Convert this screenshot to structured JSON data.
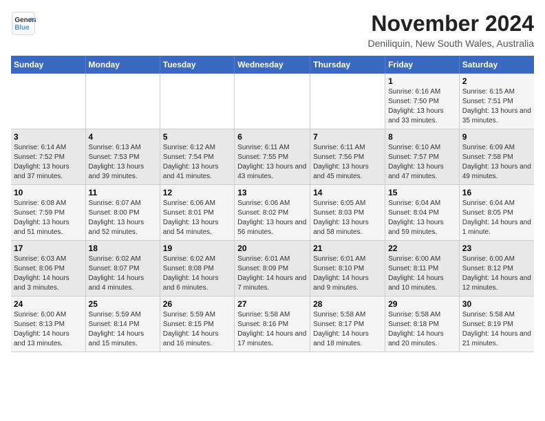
{
  "logo": {
    "line1": "General",
    "line2": "Blue"
  },
  "title": "November 2024",
  "subtitle": "Deniliquin, New South Wales, Australia",
  "weekdays": [
    "Sunday",
    "Monday",
    "Tuesday",
    "Wednesday",
    "Thursday",
    "Friday",
    "Saturday"
  ],
  "weeks": [
    [
      {
        "day": "",
        "sunrise": "",
        "sunset": "",
        "daylight": ""
      },
      {
        "day": "",
        "sunrise": "",
        "sunset": "",
        "daylight": ""
      },
      {
        "day": "",
        "sunrise": "",
        "sunset": "",
        "daylight": ""
      },
      {
        "day": "",
        "sunrise": "",
        "sunset": "",
        "daylight": ""
      },
      {
        "day": "",
        "sunrise": "",
        "sunset": "",
        "daylight": ""
      },
      {
        "day": "1",
        "sunrise": "Sunrise: 6:16 AM",
        "sunset": "Sunset: 7:50 PM",
        "daylight": "Daylight: 13 hours and 33 minutes."
      },
      {
        "day": "2",
        "sunrise": "Sunrise: 6:15 AM",
        "sunset": "Sunset: 7:51 PM",
        "daylight": "Daylight: 13 hours and 35 minutes."
      }
    ],
    [
      {
        "day": "3",
        "sunrise": "Sunrise: 6:14 AM",
        "sunset": "Sunset: 7:52 PM",
        "daylight": "Daylight: 13 hours and 37 minutes."
      },
      {
        "day": "4",
        "sunrise": "Sunrise: 6:13 AM",
        "sunset": "Sunset: 7:53 PM",
        "daylight": "Daylight: 13 hours and 39 minutes."
      },
      {
        "day": "5",
        "sunrise": "Sunrise: 6:12 AM",
        "sunset": "Sunset: 7:54 PM",
        "daylight": "Daylight: 13 hours and 41 minutes."
      },
      {
        "day": "6",
        "sunrise": "Sunrise: 6:11 AM",
        "sunset": "Sunset: 7:55 PM",
        "daylight": "Daylight: 13 hours and 43 minutes."
      },
      {
        "day": "7",
        "sunrise": "Sunrise: 6:11 AM",
        "sunset": "Sunset: 7:56 PM",
        "daylight": "Daylight: 13 hours and 45 minutes."
      },
      {
        "day": "8",
        "sunrise": "Sunrise: 6:10 AM",
        "sunset": "Sunset: 7:57 PM",
        "daylight": "Daylight: 13 hours and 47 minutes."
      },
      {
        "day": "9",
        "sunrise": "Sunrise: 6:09 AM",
        "sunset": "Sunset: 7:58 PM",
        "daylight": "Daylight: 13 hours and 49 minutes."
      }
    ],
    [
      {
        "day": "10",
        "sunrise": "Sunrise: 6:08 AM",
        "sunset": "Sunset: 7:59 PM",
        "daylight": "Daylight: 13 hours and 51 minutes."
      },
      {
        "day": "11",
        "sunrise": "Sunrise: 6:07 AM",
        "sunset": "Sunset: 8:00 PM",
        "daylight": "Daylight: 13 hours and 52 minutes."
      },
      {
        "day": "12",
        "sunrise": "Sunrise: 6:06 AM",
        "sunset": "Sunset: 8:01 PM",
        "daylight": "Daylight: 13 hours and 54 minutes."
      },
      {
        "day": "13",
        "sunrise": "Sunrise: 6:06 AM",
        "sunset": "Sunset: 8:02 PM",
        "daylight": "Daylight: 13 hours and 56 minutes."
      },
      {
        "day": "14",
        "sunrise": "Sunrise: 6:05 AM",
        "sunset": "Sunset: 8:03 PM",
        "daylight": "Daylight: 13 hours and 58 minutes."
      },
      {
        "day": "15",
        "sunrise": "Sunrise: 6:04 AM",
        "sunset": "Sunset: 8:04 PM",
        "daylight": "Daylight: 13 hours and 59 minutes."
      },
      {
        "day": "16",
        "sunrise": "Sunrise: 6:04 AM",
        "sunset": "Sunset: 8:05 PM",
        "daylight": "Daylight: 14 hours and 1 minute."
      }
    ],
    [
      {
        "day": "17",
        "sunrise": "Sunrise: 6:03 AM",
        "sunset": "Sunset: 8:06 PM",
        "daylight": "Daylight: 14 hours and 3 minutes."
      },
      {
        "day": "18",
        "sunrise": "Sunrise: 6:02 AM",
        "sunset": "Sunset: 8:07 PM",
        "daylight": "Daylight: 14 hours and 4 minutes."
      },
      {
        "day": "19",
        "sunrise": "Sunrise: 6:02 AM",
        "sunset": "Sunset: 8:08 PM",
        "daylight": "Daylight: 14 hours and 6 minutes."
      },
      {
        "day": "20",
        "sunrise": "Sunrise: 6:01 AM",
        "sunset": "Sunset: 8:09 PM",
        "daylight": "Daylight: 14 hours and 7 minutes."
      },
      {
        "day": "21",
        "sunrise": "Sunrise: 6:01 AM",
        "sunset": "Sunset: 8:10 PM",
        "daylight": "Daylight: 14 hours and 9 minutes."
      },
      {
        "day": "22",
        "sunrise": "Sunrise: 6:00 AM",
        "sunset": "Sunset: 8:11 PM",
        "daylight": "Daylight: 14 hours and 10 minutes."
      },
      {
        "day": "23",
        "sunrise": "Sunrise: 6:00 AM",
        "sunset": "Sunset: 8:12 PM",
        "daylight": "Daylight: 14 hours and 12 minutes."
      }
    ],
    [
      {
        "day": "24",
        "sunrise": "Sunrise: 6:00 AM",
        "sunset": "Sunset: 8:13 PM",
        "daylight": "Daylight: 14 hours and 13 minutes."
      },
      {
        "day": "25",
        "sunrise": "Sunrise: 5:59 AM",
        "sunset": "Sunset: 8:14 PM",
        "daylight": "Daylight: 14 hours and 15 minutes."
      },
      {
        "day": "26",
        "sunrise": "Sunrise: 5:59 AM",
        "sunset": "Sunset: 8:15 PM",
        "daylight": "Daylight: 14 hours and 16 minutes."
      },
      {
        "day": "27",
        "sunrise": "Sunrise: 5:58 AM",
        "sunset": "Sunset: 8:16 PM",
        "daylight": "Daylight: 14 hours and 17 minutes."
      },
      {
        "day": "28",
        "sunrise": "Sunrise: 5:58 AM",
        "sunset": "Sunset: 8:17 PM",
        "daylight": "Daylight: 14 hours and 18 minutes."
      },
      {
        "day": "29",
        "sunrise": "Sunrise: 5:58 AM",
        "sunset": "Sunset: 8:18 PM",
        "daylight": "Daylight: 14 hours and 20 minutes."
      },
      {
        "day": "30",
        "sunrise": "Sunrise: 5:58 AM",
        "sunset": "Sunset: 8:19 PM",
        "daylight": "Daylight: 14 hours and 21 minutes."
      }
    ]
  ]
}
